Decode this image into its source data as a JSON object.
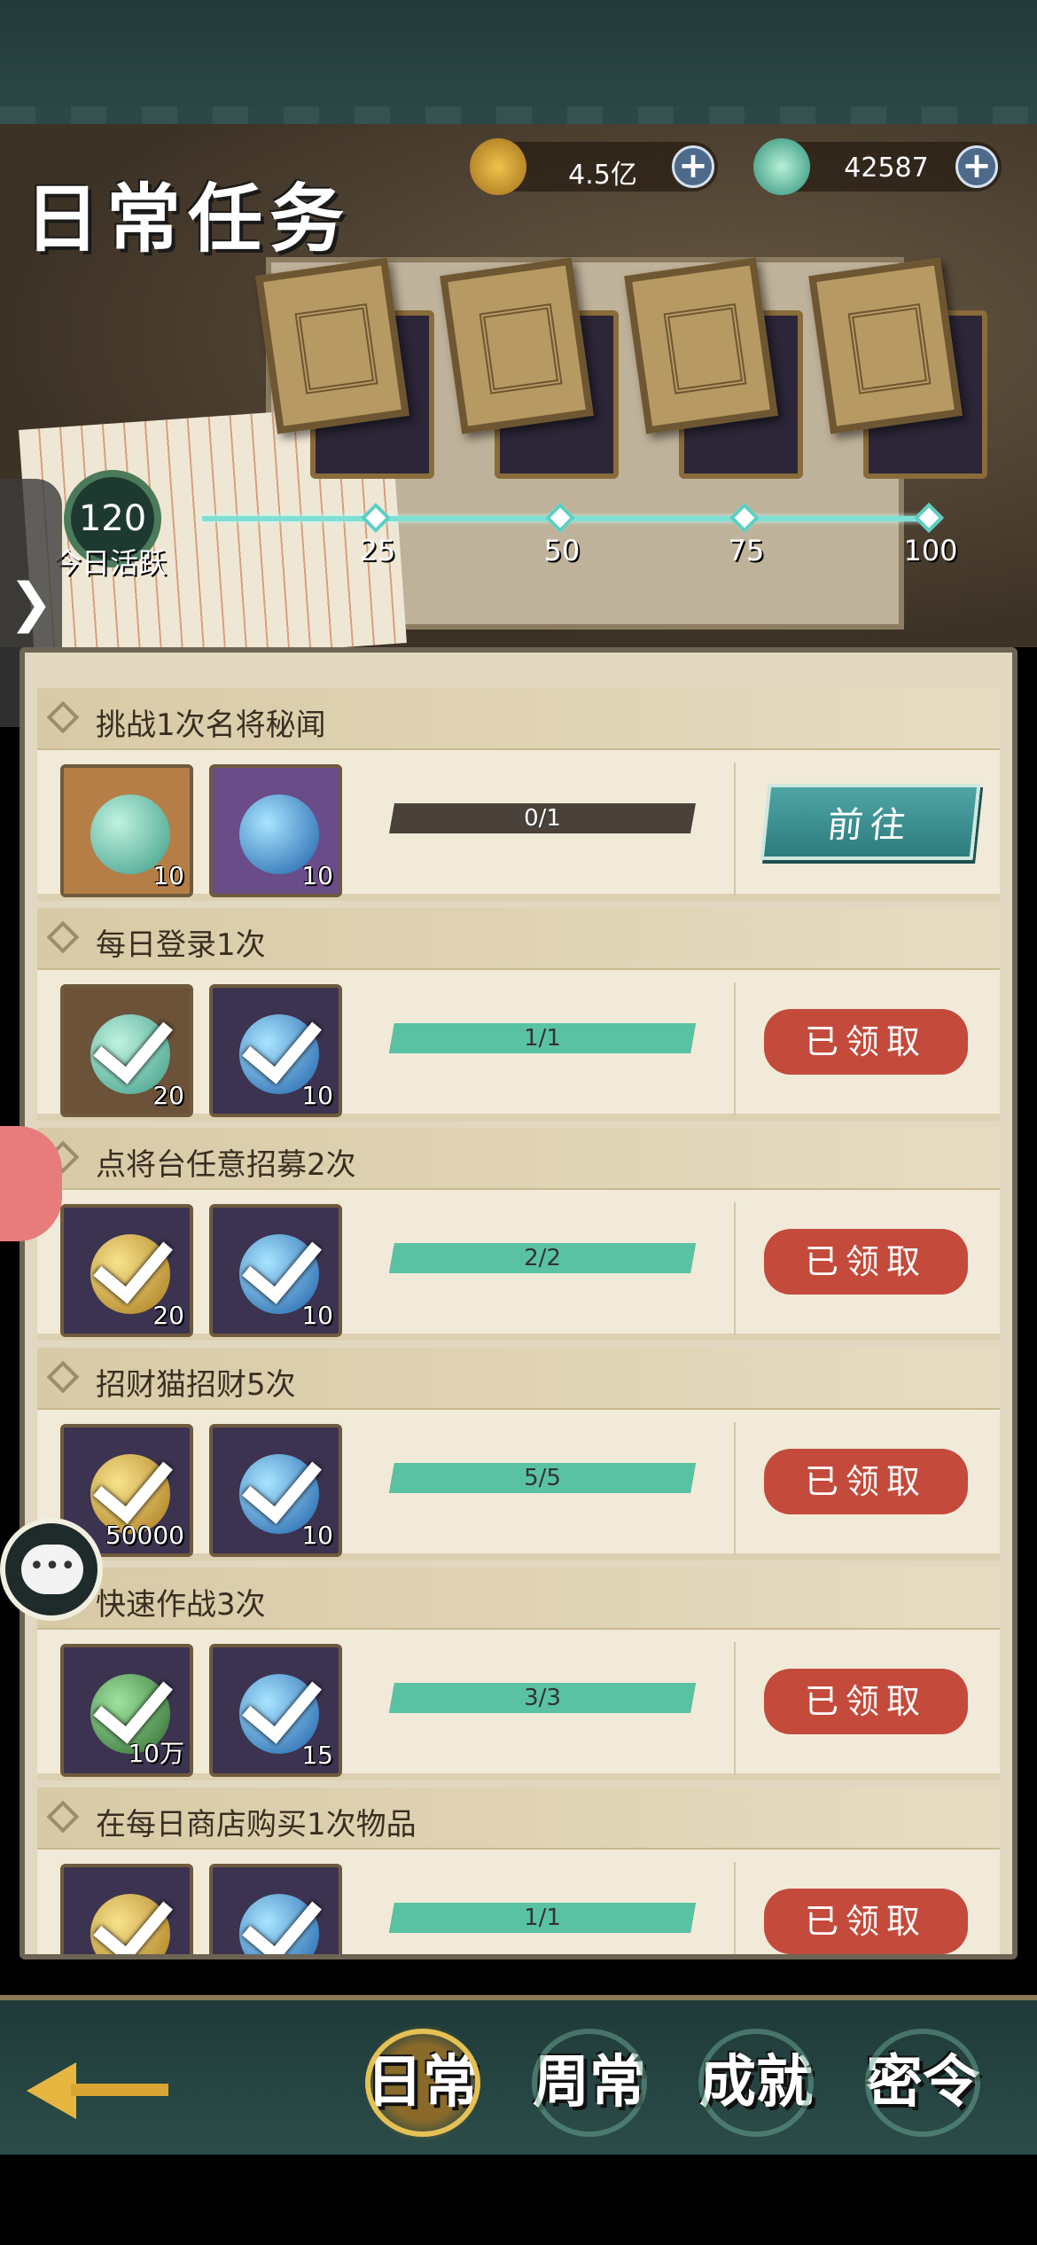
{
  "header": {
    "title": "日常任务",
    "currency": [
      {
        "icon": "gold-coin-icon",
        "value": "4.5亿"
      },
      {
        "icon": "jade-icon",
        "value": "42587"
      }
    ],
    "activity": {
      "points": "120",
      "label": "今日活跃",
      "milestones": [
        "25",
        "50",
        "75",
        "100"
      ]
    }
  },
  "tasks": [
    {
      "name": "挑战1次名将秘闻",
      "rewards": [
        {
          "kind": "jade",
          "qty": "10",
          "done": false
        },
        {
          "kind": "dragon-orb",
          "qty": "10",
          "done": false
        }
      ],
      "progress": "0/1",
      "progress_fraction": 0,
      "button": "前往",
      "state": "go"
    },
    {
      "name": "每日登录1次",
      "rewards": [
        {
          "kind": "jade",
          "qty": "20",
          "done": true
        },
        {
          "kind": "dragon-orb",
          "qty": "10",
          "done": true
        }
      ],
      "progress": "1/1",
      "progress_fraction": 1,
      "button": "已领取",
      "state": "claimed"
    },
    {
      "name": "点将台任意招募2次",
      "rewards": [
        {
          "kind": "gold-orb",
          "qty": "20",
          "done": true
        },
        {
          "kind": "dragon-orb",
          "qty": "10",
          "done": true
        }
      ],
      "progress": "2/2",
      "progress_fraction": 1,
      "button": "已领取",
      "state": "claimed"
    },
    {
      "name": "招财猫招财5次",
      "rewards": [
        {
          "kind": "coin",
          "qty": "50000",
          "done": true
        },
        {
          "kind": "dragon-orb",
          "qty": "10",
          "done": true
        }
      ],
      "progress": "5/5",
      "progress_fraction": 1,
      "button": "已领取",
      "state": "claimed"
    },
    {
      "name": "快速作战3次",
      "rewards": [
        {
          "kind": "green-orb",
          "qty": "10万",
          "done": true
        },
        {
          "kind": "dragon-orb",
          "qty": "15",
          "done": true
        }
      ],
      "progress": "3/3",
      "progress_fraction": 1,
      "button": "已领取",
      "state": "claimed"
    },
    {
      "name": "在每日商店购买1次物品",
      "rewards": [
        {
          "kind": "coin",
          "qty": "",
          "done": true
        },
        {
          "kind": "dragon-orb",
          "qty": "",
          "done": true
        }
      ],
      "progress": "1/1",
      "progress_fraction": 1,
      "button": "已领取",
      "state": "claimed"
    }
  ],
  "nav": {
    "tabs": [
      {
        "label": "日常",
        "active": true
      },
      {
        "label": "周常",
        "active": false
      },
      {
        "label": "成就",
        "active": false
      },
      {
        "label": "密令",
        "active": false
      }
    ]
  },
  "chat_bubble": "•••"
}
